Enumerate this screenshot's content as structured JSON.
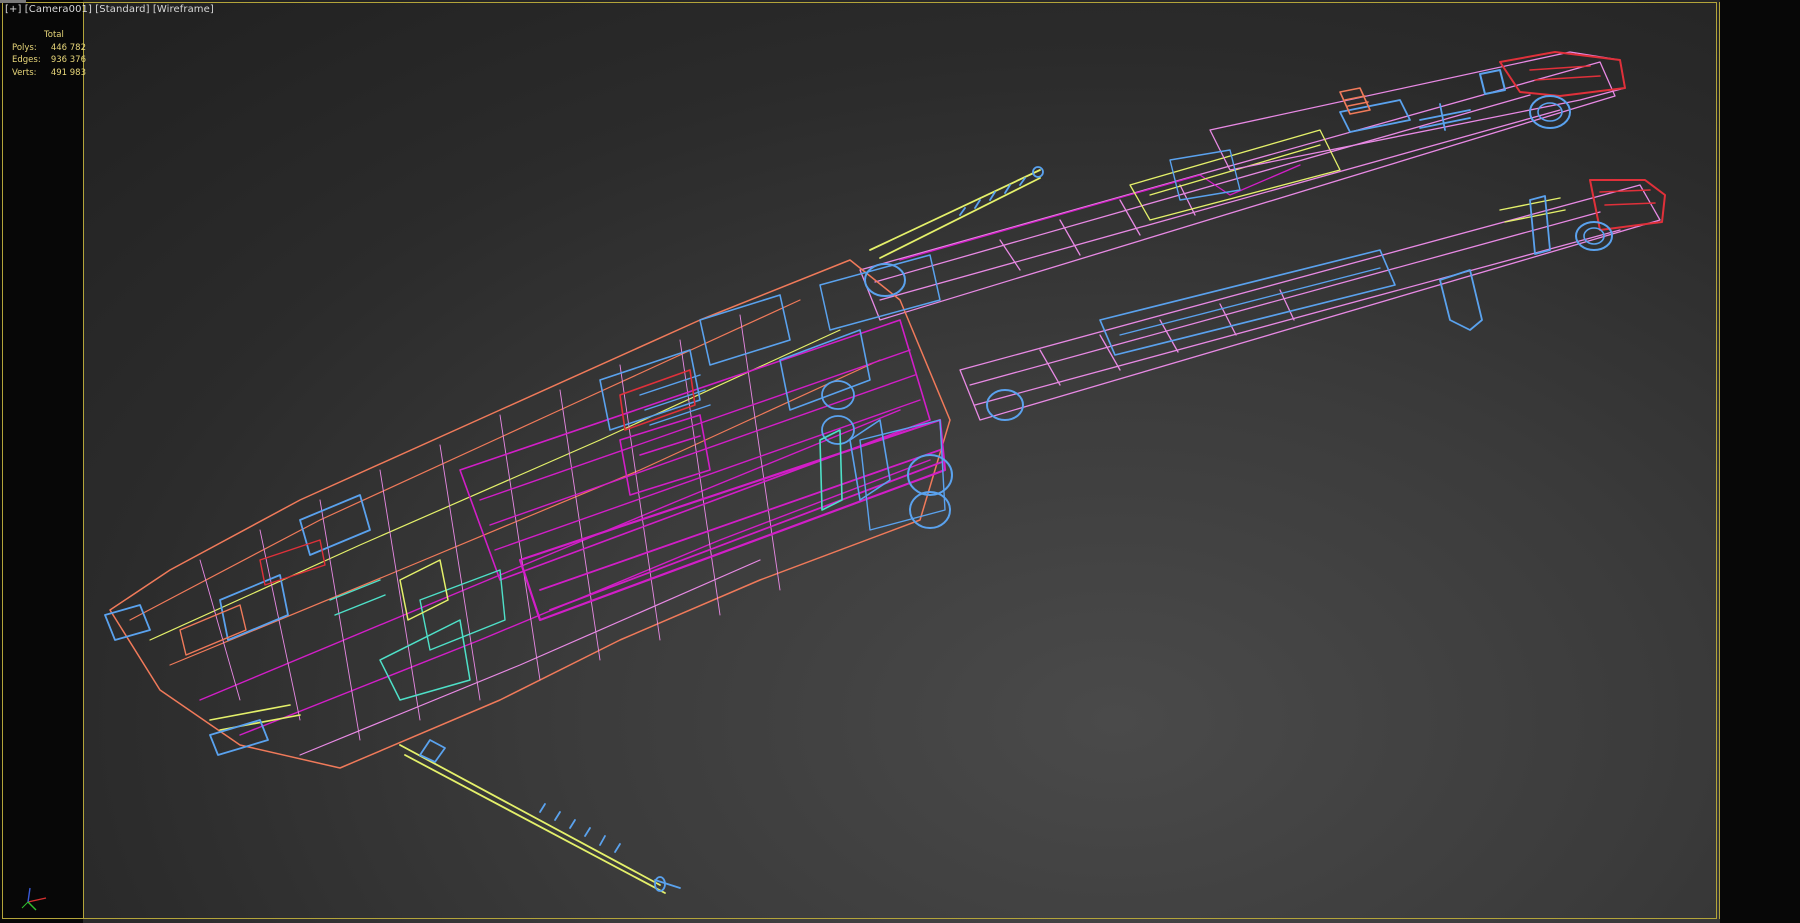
{
  "viewport": {
    "menu_plus": "[+]",
    "camera": "[Camera001]",
    "shading_standard": "[Standard]",
    "shading_mode": "[Wireframe]"
  },
  "stats": {
    "header": "Total",
    "rows": [
      {
        "label": "Polys:",
        "value": "446 782"
      },
      {
        "label": "Edges:",
        "value": "936 376"
      },
      {
        "label": "Verts:",
        "value": "491 983"
      }
    ]
  },
  "colors": {
    "frame": "#b3a43a",
    "stats_text": "#e8d77a",
    "wire_magenta": "#d21ec8",
    "wire_pink": "#e889e4",
    "wire_blue": "#5aa2ee",
    "wire_yellow": "#e4f06a",
    "wire_red": "#e0303a",
    "wire_orange": "#f07a5a",
    "wire_cyan": "#4ee0c8"
  },
  "icons": {
    "axis_gizmo": "axis-tripod-icon"
  }
}
